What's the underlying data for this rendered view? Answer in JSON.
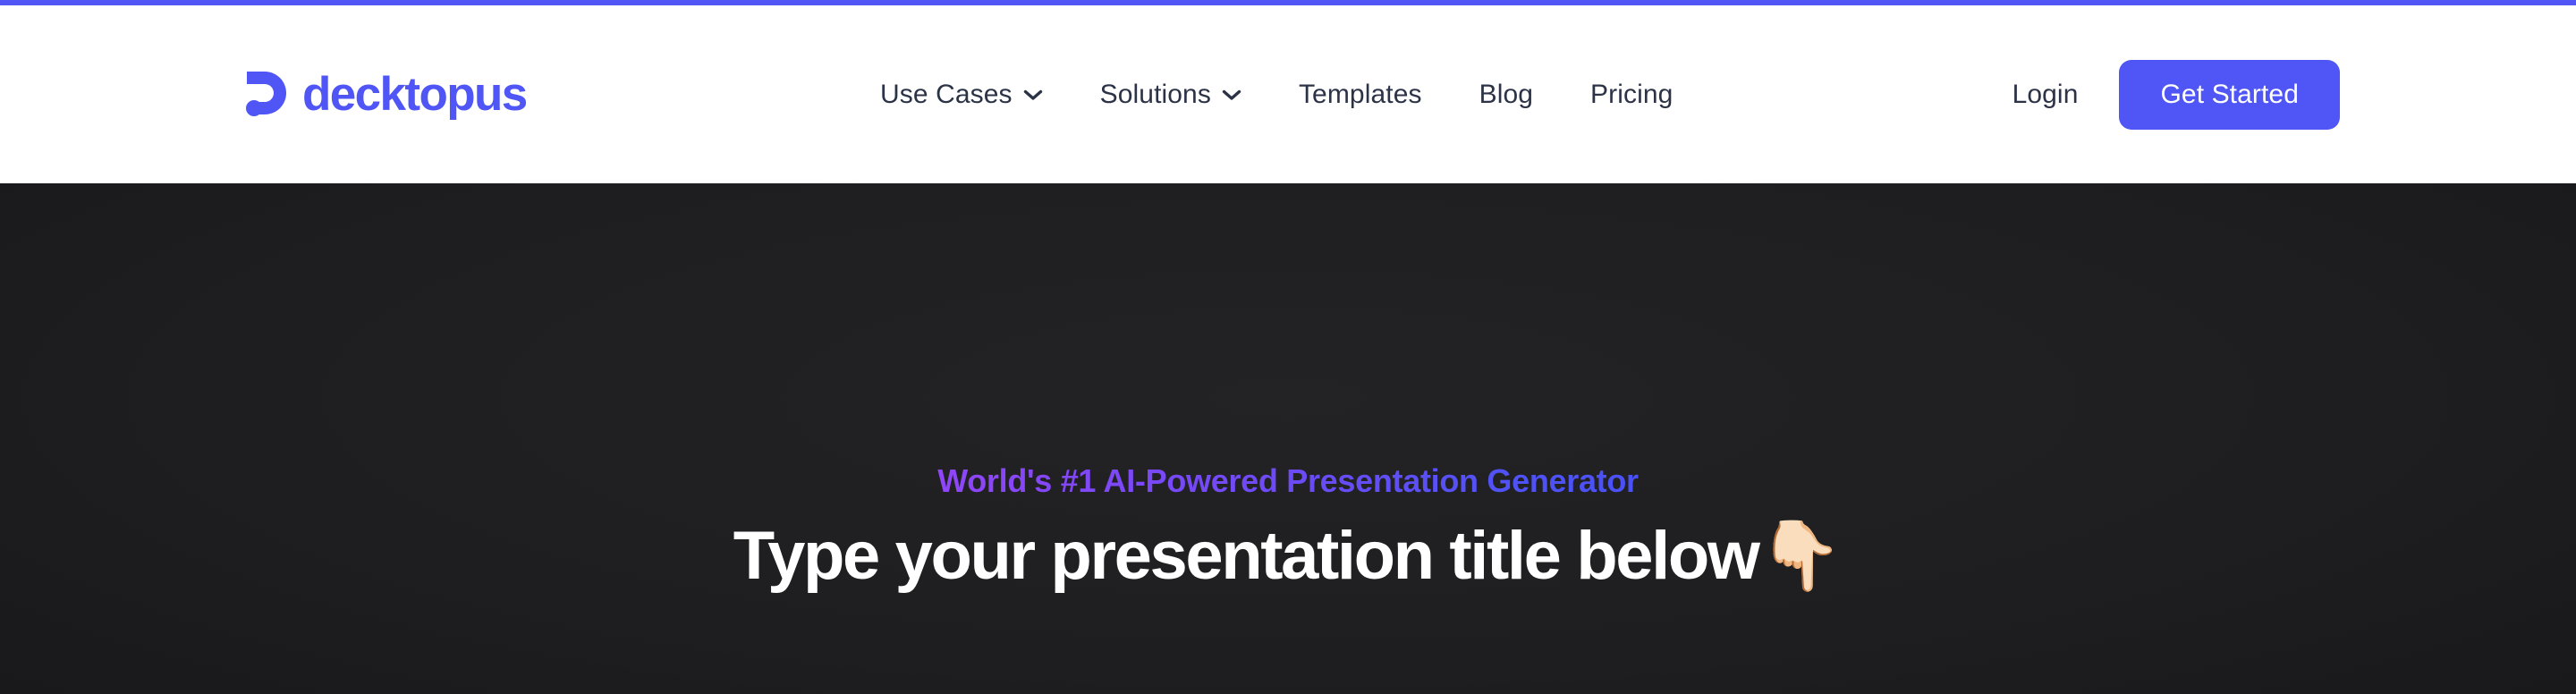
{
  "theme": {
    "brand_purple": "#4f56f5",
    "accent_gradient_start": "#9046f8",
    "accent_gradient_end": "#4a51f6",
    "nav_text": "#2c3347",
    "hero_background": "#1c1c1e",
    "cta_background": "#4f56f5",
    "cta_text": "#ffffff"
  },
  "topbar": {
    "color": "#4f56f5"
  },
  "header": {
    "logo": {
      "wordmark": "decktopus",
      "mark_icon": "decktopus-d-mark-icon",
      "color": "#4f56f5"
    },
    "nav": [
      {
        "label": "Use Cases",
        "has_dropdown": true,
        "icon": "chevron-down-icon"
      },
      {
        "label": "Solutions",
        "has_dropdown": true,
        "icon": "chevron-down-icon"
      },
      {
        "label": "Templates",
        "has_dropdown": false,
        "icon": ""
      },
      {
        "label": "Blog",
        "has_dropdown": false,
        "icon": ""
      },
      {
        "label": "Pricing",
        "has_dropdown": false,
        "icon": ""
      }
    ],
    "actions": {
      "login_label": "Login",
      "cta_label": "Get Started"
    }
  },
  "hero": {
    "eyebrow": "World's #1 AI-Powered Presentation Generator",
    "headline": "Type your presentation title below",
    "headline_emoji": "👇🏻",
    "headline_emoji_name": "backhand-index-pointing-down-emoji"
  }
}
